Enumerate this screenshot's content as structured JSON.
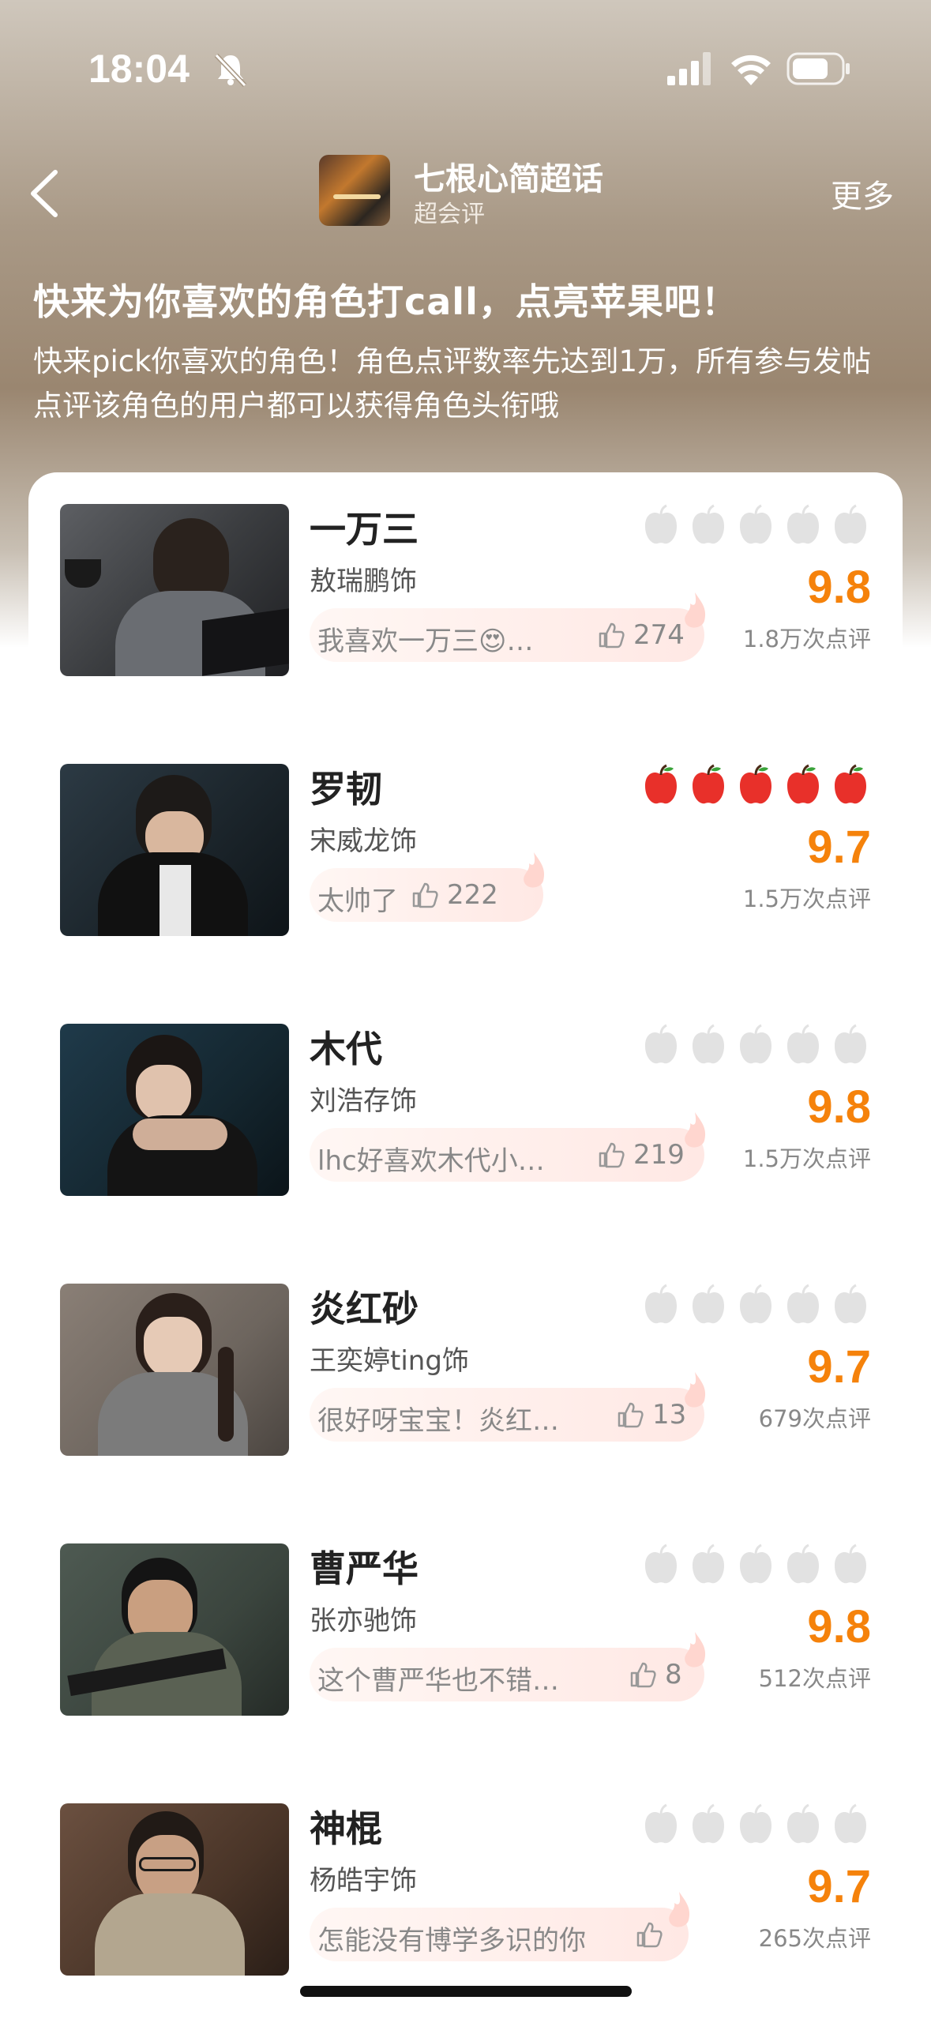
{
  "status_bar": {
    "time": "18:04"
  },
  "nav": {
    "topic_title": "七根心简超话",
    "topic_subtitle": "超会评",
    "more_label": "更多"
  },
  "promo": {
    "title": "快来为你喜欢的角色打call，点亮苹果吧！",
    "description": "快来pick你喜欢的角色！角色点评数率先达到1万，所有参与发帖点评该角色的用户都可以获得角色头衔哦"
  },
  "characters": [
    {
      "name": "一万三",
      "actor": "敖瑞鹏饰",
      "comment": "我喜欢一万三😍…",
      "likes": "274",
      "score": "9.8",
      "reviews": "1.8万次点评",
      "apples_lit": false
    },
    {
      "name": "罗韧",
      "actor": "宋威龙饰",
      "comment": "太帅了",
      "likes": "222",
      "score": "9.7",
      "reviews": "1.5万次点评",
      "apples_lit": true
    },
    {
      "name": "木代",
      "actor": "刘浩存饰",
      "comment": "lhc好喜欢木代小…",
      "likes": "219",
      "score": "9.8",
      "reviews": "1.5万次点评",
      "apples_lit": false
    },
    {
      "name": "炎红砂",
      "actor": "王奕婷ting饰",
      "comment": "很好呀宝宝！炎红…",
      "likes": "13",
      "score": "9.7",
      "reviews": "679次点评",
      "apples_lit": false
    },
    {
      "name": "曹严华",
      "actor": "张亦驰饰",
      "comment": "这个曹严华也不错…",
      "likes": "8",
      "score": "9.8",
      "reviews": "512次点评",
      "apples_lit": false
    },
    {
      "name": "神棍",
      "actor": "杨皓宇饰",
      "comment": "怎能没有博学多识的你",
      "likes": "",
      "score": "9.7",
      "reviews": "265次点评",
      "apples_lit": false
    }
  ],
  "colors": {
    "score_orange": "#f5820b",
    "apple_red": "#e8302a",
    "apple_grey": "#e2e2e2"
  }
}
